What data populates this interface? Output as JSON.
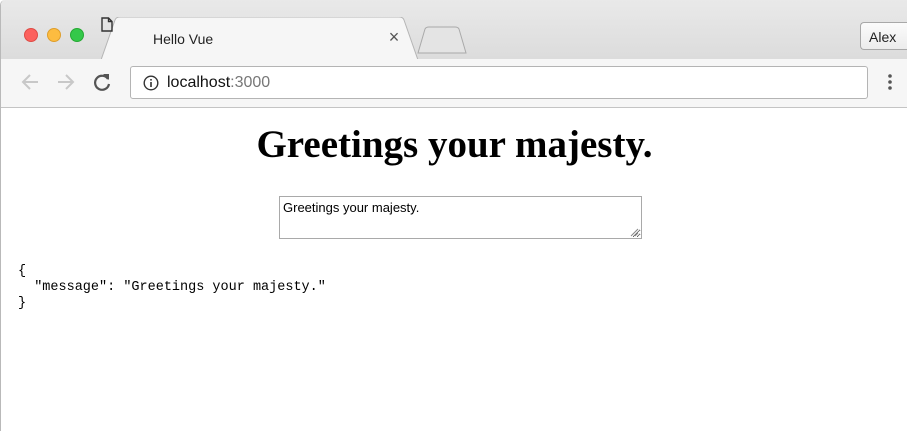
{
  "browser": {
    "tab": {
      "title": "Hello Vue",
      "close_glyph": "×",
      "favicon": "page-icon"
    },
    "profile_label": "Alex",
    "address": {
      "host": "localhost",
      "port": ":3000",
      "icon": "info-icon"
    },
    "nav": {
      "back": "arrow-left-icon",
      "forward": "arrow-right-icon",
      "reload": "reload-icon",
      "menu": "kebab-menu-icon"
    }
  },
  "page": {
    "heading": "Greetings your majesty.",
    "input_value": "Greetings your majesty.",
    "json_output": "{\n  \"message\": \"Greetings your majesty.\"\n}"
  },
  "colors": {
    "traffic_close": "#fc615d",
    "traffic_minimize": "#fdbc40",
    "traffic_maximize": "#34c84a"
  }
}
